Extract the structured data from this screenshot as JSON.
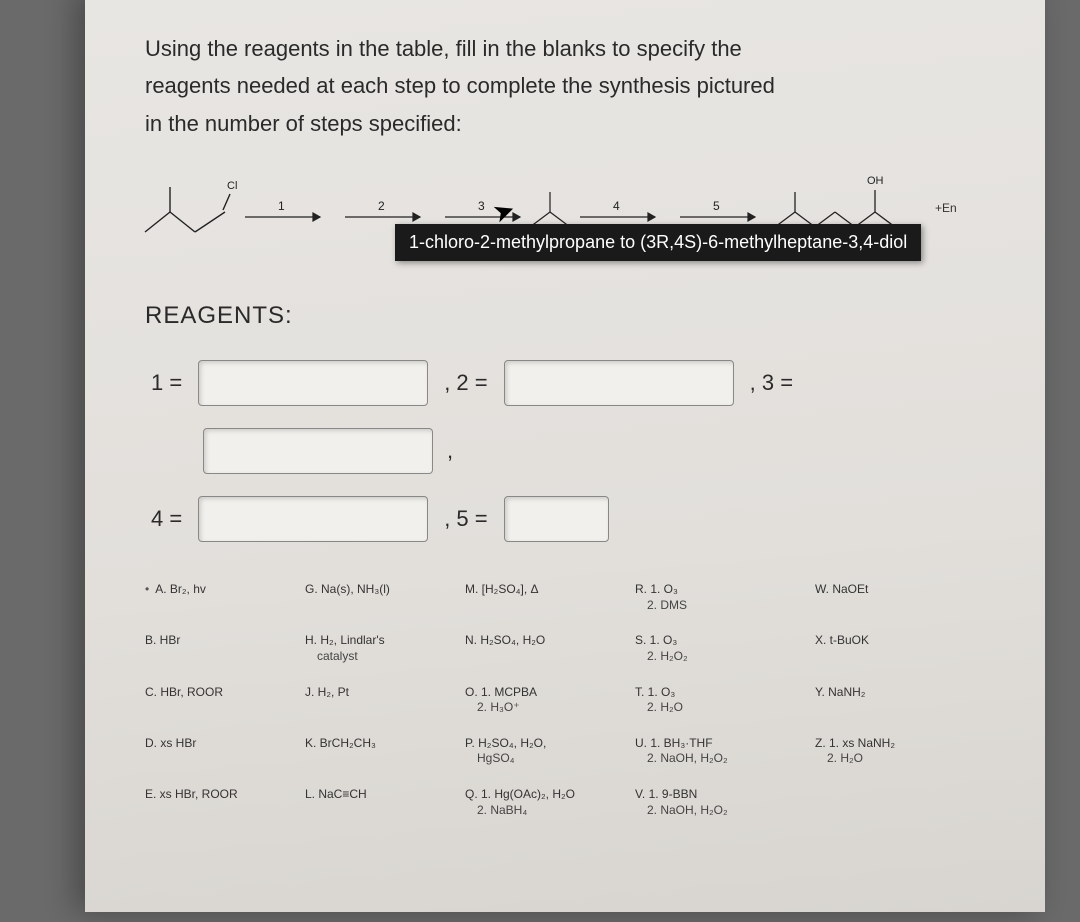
{
  "prompt": {
    "line1": "Using the reagents in the table, fill in the blanks to specify the",
    "line2": "reagents needed at each step to complete the synthesis pictured",
    "line3": "in the number of steps specified:"
  },
  "scheme": {
    "start_label_cl": "Cl",
    "step_labels": [
      "1",
      "2",
      "3",
      "4",
      "5"
    ],
    "end_oh": "OH",
    "end_enant": "+En",
    "tooltip": "1-chloro-2-methylpropane to (3R,4S)-6-methylheptane-3,4-diol"
  },
  "heading": "REAGENTS:",
  "blanks": {
    "l1": "1 =",
    "l2": ", 2 =",
    "l3": ", 3 =",
    "l4": "4 =",
    "l5": ", 5 ="
  },
  "reagents": {
    "A": "A. Br₂, hv",
    "B": "B. HBr",
    "C": "C. HBr, ROOR",
    "D": "D. xs HBr",
    "E": "E. xs HBr, ROOR",
    "G": "G. Na(s), NH₃(l)",
    "H": "H. H₂, Lindlar's",
    "H2": "catalyst",
    "J": "J. H₂, Pt",
    "K": "K. BrCH₂CH₃",
    "L": "L. NaC≡CH",
    "M": "M. [H₂SO₄], Δ",
    "N": "N. H₂SO₄, H₂O",
    "O": "O. 1. MCPBA",
    "O2": "2. H₃O⁺",
    "P": "P. H₂SO₄, H₂O,",
    "P2": "HgSO₄",
    "Q": "Q. 1. Hg(OAc)₂, H₂O",
    "Q2": "2. NaBH₄",
    "R": "R. 1. O₃",
    "R2": "2. DMS",
    "S": "S. 1. O₃",
    "S2": "2. H₂O₂",
    "T": "T. 1. O₃",
    "T2": "2. H₂O",
    "U": "U. 1. BH₃·THF",
    "U2": "2. NaOH, H₂O₂",
    "V": "V. 1. 9-BBN",
    "V2": "2. NaOH, H₂O₂",
    "W": "W. NaOEt",
    "X": "X. t-BuOK",
    "Y": "Y. NaNH₂",
    "Z": "Z. 1. xs NaNH₂",
    "Z2": "2. H₂O"
  }
}
